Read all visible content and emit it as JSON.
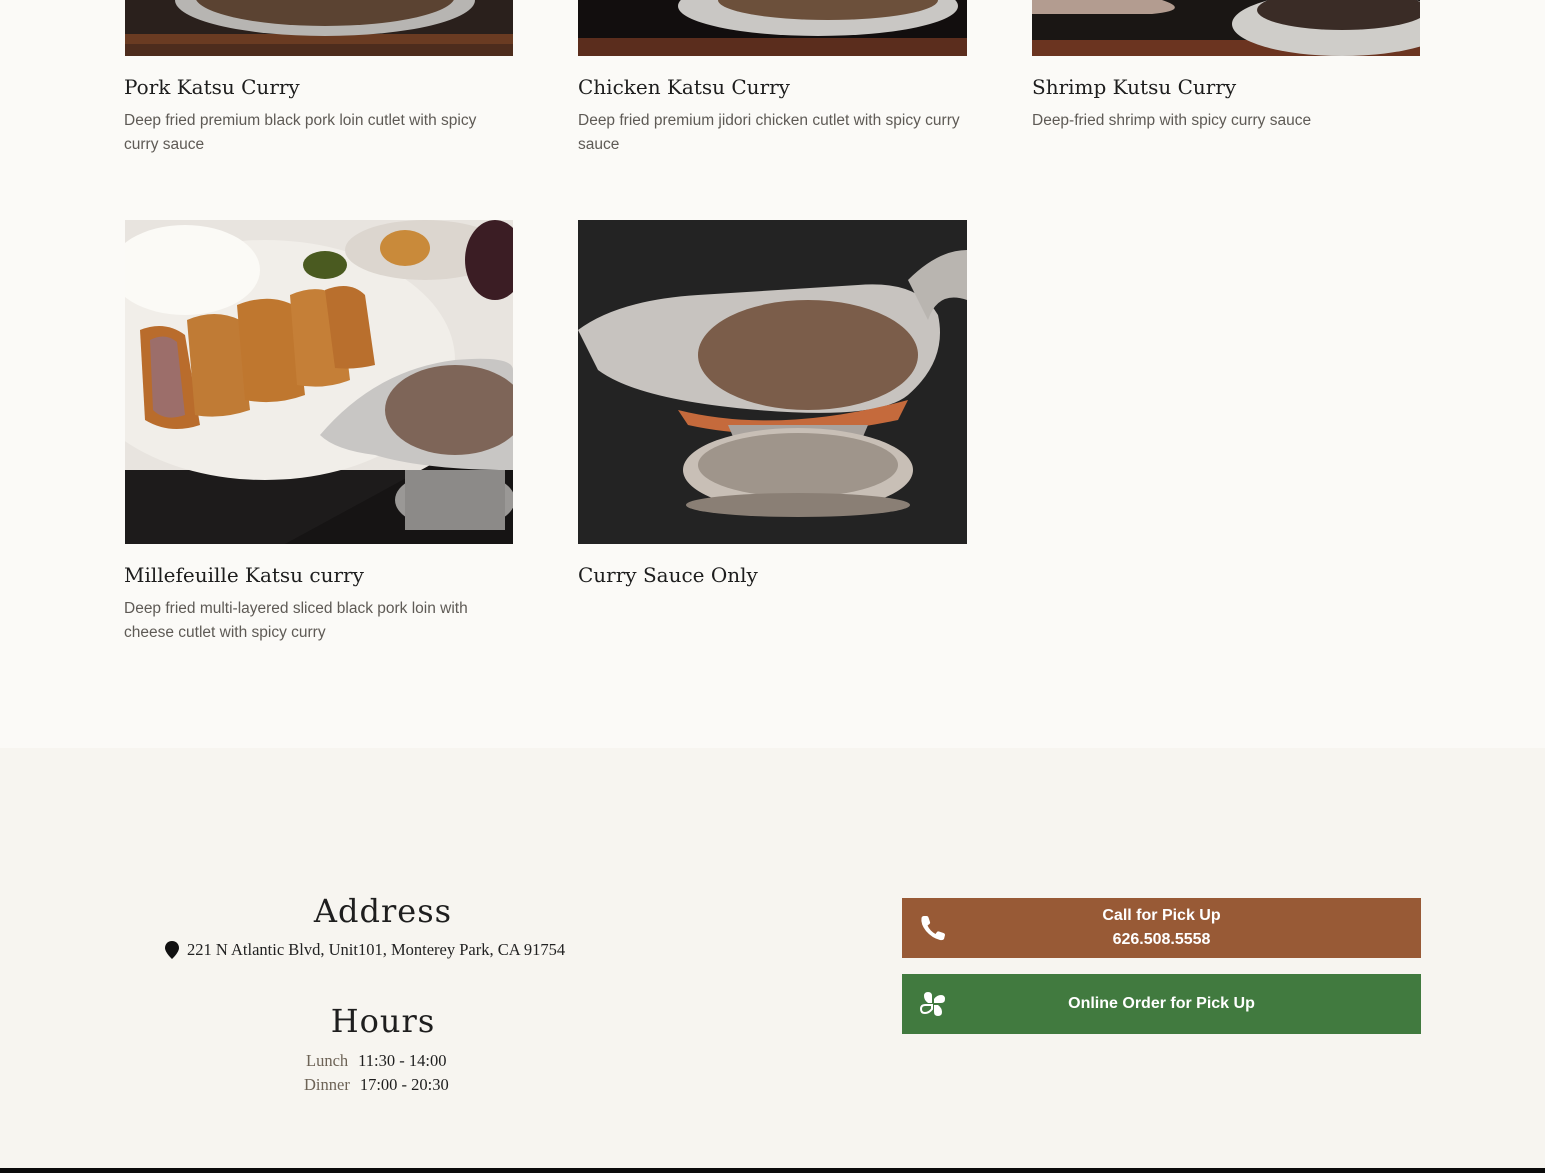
{
  "menu_items": [
    {
      "title": "Pork Katsu Curry",
      "description": "Deep fried premium black pork loin cutlet with spicy curry sauce"
    },
    {
      "title": "Chicken Katsu Curry",
      "description": "Deep fried premium jidori chicken cutlet with spicy curry sauce"
    },
    {
      "title": "Shrimp Kutsu Curry",
      "description": "Deep-fried shrimp with spicy curry sauce"
    },
    {
      "title": "Millefeuille Katsu curry",
      "description": "Deep fried multi-layered sliced black pork loin with cheese cutlet with spicy curry"
    },
    {
      "title": "Curry Sauce Only",
      "description": ""
    }
  ],
  "info": {
    "address_heading": "Address",
    "address_icon": "map-pin-icon",
    "address": "221 N Atlantic Blvd, Unit101, Monterey Park, CA 91754",
    "hours_heading": "Hours",
    "hours": [
      {
        "label": "Lunch",
        "time": "11:30 - 14:00"
      },
      {
        "label": "Dinner",
        "time": "17:00 - 20:30"
      }
    ]
  },
  "actions": {
    "call": {
      "line1": "Call for Pick Up",
      "line2": "626.508.5558",
      "icon": "phone-icon",
      "color": "#985a36"
    },
    "order": {
      "label": "Online Order for Pick Up",
      "icon": "clover-icon",
      "color": "#417a3f"
    }
  }
}
